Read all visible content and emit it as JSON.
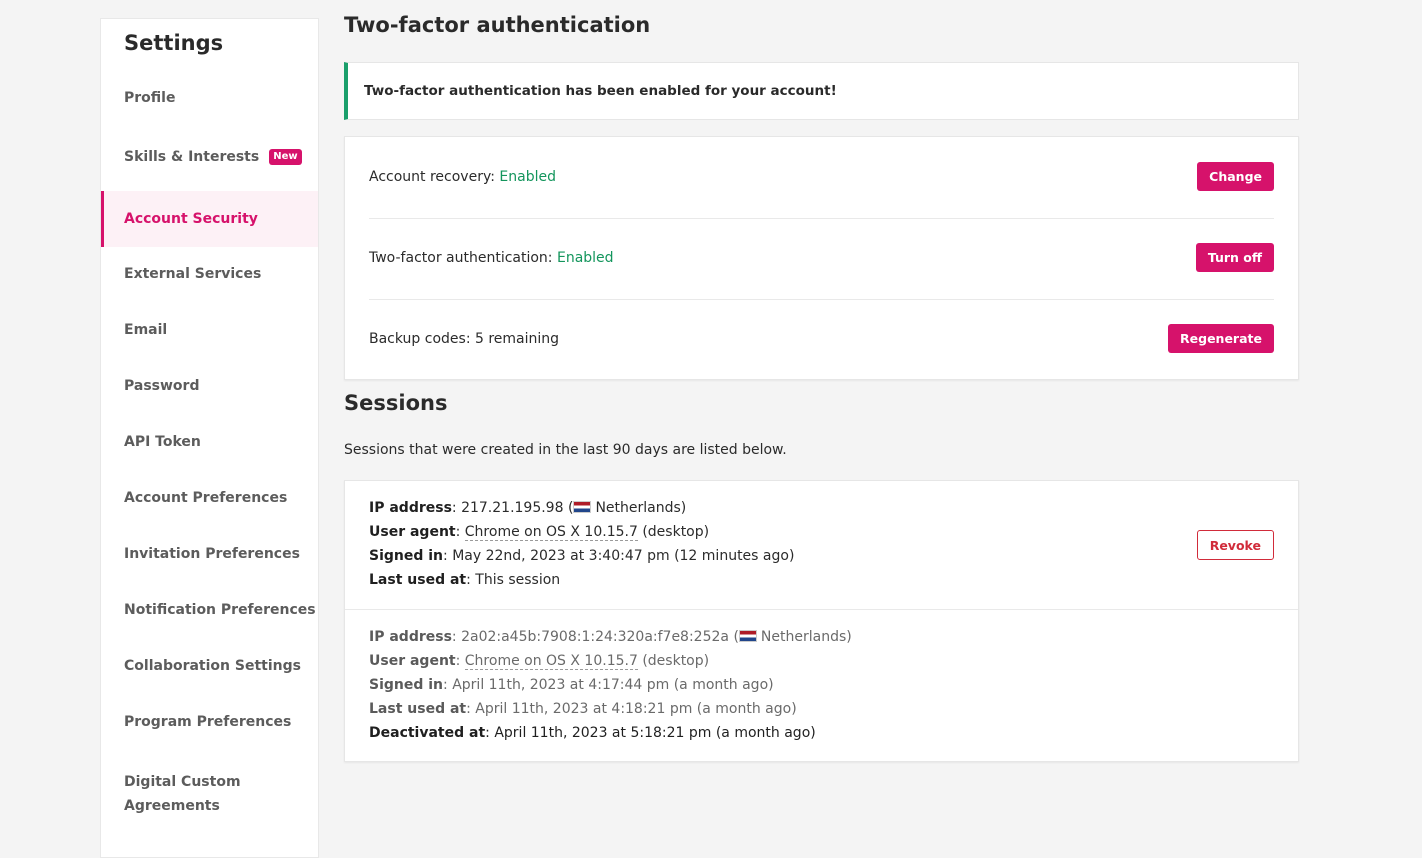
{
  "sidebar": {
    "title": "Settings",
    "items": [
      {
        "label": "Profile"
      },
      {
        "label": "Skills & Interests",
        "badge": "New"
      },
      {
        "label": "Account Security",
        "active": true
      },
      {
        "label": "External Services"
      },
      {
        "label": "Email"
      },
      {
        "label": "Password"
      },
      {
        "label": "API Token"
      },
      {
        "label": "Account Preferences"
      },
      {
        "label": "Invitation Preferences"
      },
      {
        "label": "Notification Preferences"
      },
      {
        "label": "Collaboration Settings"
      },
      {
        "label": "Program Preferences"
      },
      {
        "label": "Digital Custom Agreements"
      }
    ]
  },
  "main": {
    "title": "Two-factor authentication",
    "alert": "Two-factor authentication has been enabled for your account!",
    "security": {
      "recovery_label": "Account recovery:",
      "recovery_status": "Enabled",
      "recovery_button": "Change",
      "tfa_label": "Two-factor authentication:",
      "tfa_status": "Enabled",
      "tfa_button": "Turn off",
      "backup_label": "Backup codes: 5 remaining",
      "backup_button": "Regenerate"
    },
    "sessions": {
      "title": "Sessions",
      "description": "Sessions that were created in the last 90 days are listed below.",
      "labels": {
        "ip": "IP address",
        "ua": "User agent",
        "signed_in": "Signed in",
        "last_used": "Last used at",
        "deactivated": "Deactivated at"
      },
      "items": [
        {
          "ip": "217.21.195.98",
          "country": "Netherlands",
          "ua": "Chrome on OS X 10.15.7",
          "device": "(desktop)",
          "signed_in": "May 22nd, 2023 at 3:40:47 pm (12 minutes ago)",
          "last_used": "This session",
          "revoke_label": "Revoke"
        },
        {
          "ip": "2a02:a45b:7908:1:24:320a:f7e8:252a",
          "country": "Netherlands",
          "ua": "Chrome on OS X 10.15.7",
          "device": "(desktop)",
          "signed_in": "April 11th, 2023 at 4:17:44 pm (a month ago)",
          "last_used": "April 11th, 2023 at 4:18:21 pm (a month ago)",
          "deactivated": "April 11th, 2023 at 5:18:21 pm (a month ago)"
        }
      ]
    }
  },
  "colors": {
    "accent": "#d6126b",
    "success": "#13955c",
    "danger": "#d12b3a"
  }
}
